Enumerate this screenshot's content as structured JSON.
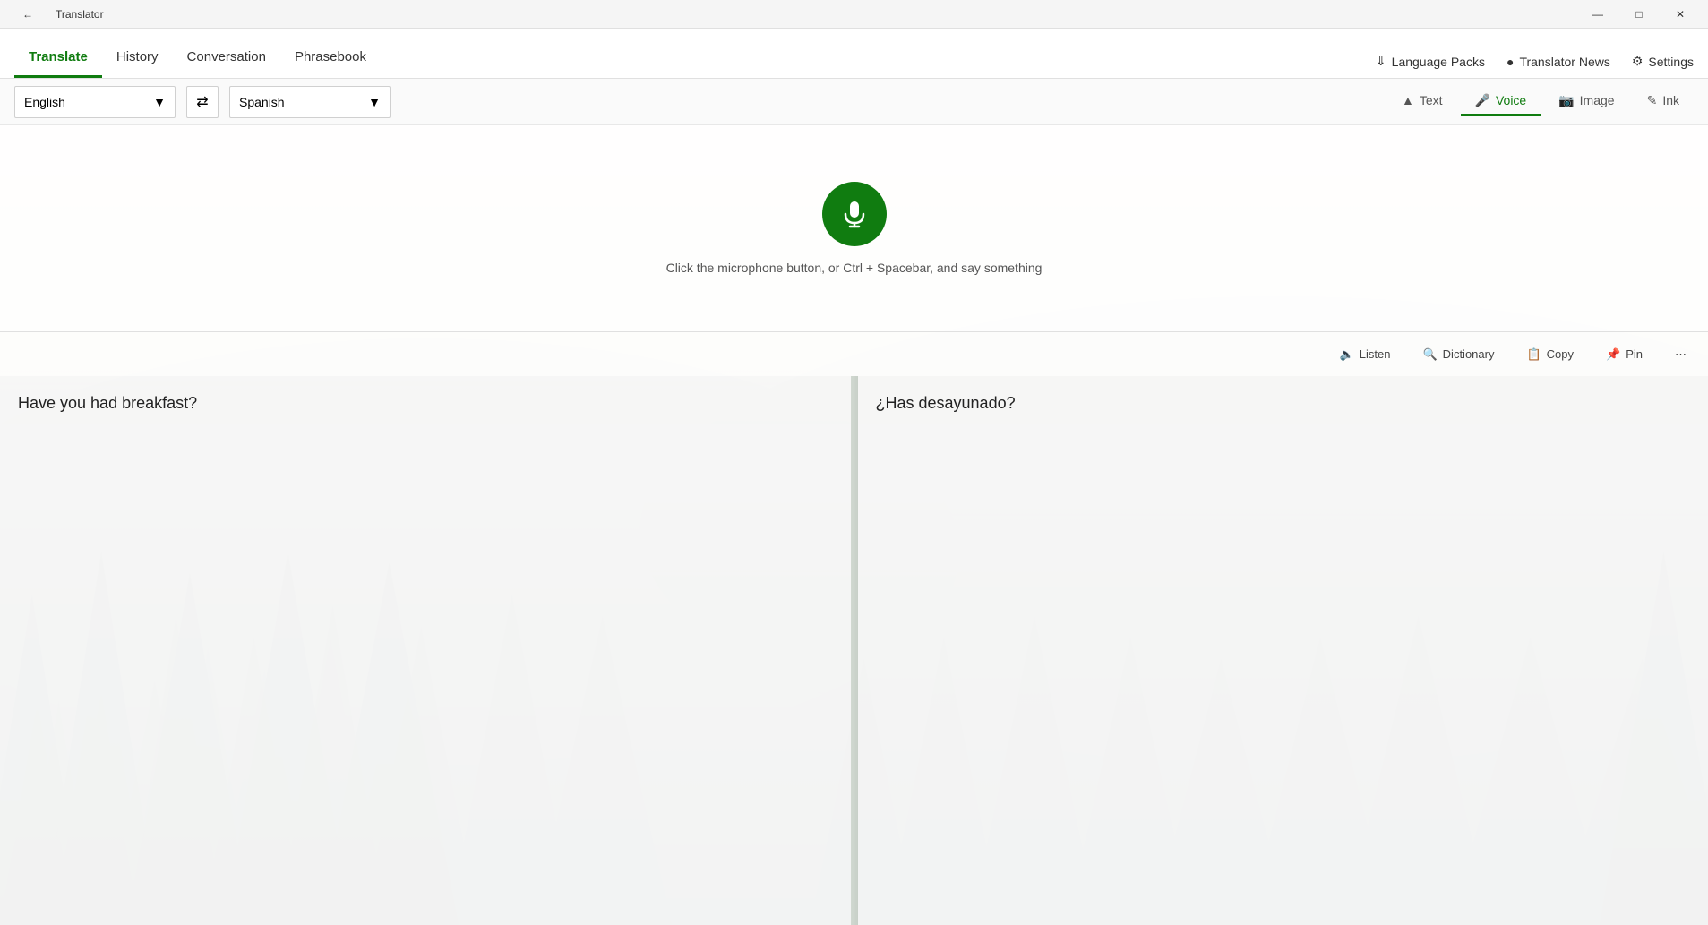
{
  "titleBar": {
    "title": "Translator",
    "back": "←",
    "minimize": "—",
    "restore": "□",
    "close": "✕"
  },
  "nav": {
    "tabs": [
      {
        "id": "translate",
        "label": "Translate",
        "active": true
      },
      {
        "id": "history",
        "label": "History",
        "active": false
      },
      {
        "id": "conversation",
        "label": "Conversation",
        "active": false
      },
      {
        "id": "phrasebook",
        "label": "Phrasebook",
        "active": false
      }
    ],
    "rightItems": [
      {
        "id": "language-packs",
        "label": "Language Packs",
        "icon": "download"
      },
      {
        "id": "translator-news",
        "label": "Translator News",
        "icon": "globe"
      },
      {
        "id": "settings",
        "label": "Settings",
        "icon": "gear"
      }
    ]
  },
  "langBar": {
    "sourceLang": "English",
    "targetLang": "Spanish",
    "swapIcon": "⇄",
    "modeTabs": [
      {
        "id": "text",
        "label": "Text",
        "active": false,
        "icon": "text"
      },
      {
        "id": "voice",
        "label": "Voice",
        "active": true,
        "icon": "microphone"
      },
      {
        "id": "image",
        "label": "Image",
        "active": false,
        "icon": "image"
      },
      {
        "id": "ink",
        "label": "Ink",
        "active": false,
        "icon": "pen"
      }
    ]
  },
  "recording": {
    "micIcon": "🎙",
    "hint": "Click the microphone button, or Ctrl + Spacebar, and say something"
  },
  "actionBar": {
    "listen": "Listen",
    "dictionary": "Dictionary",
    "copy": "Copy",
    "pin": "Pin",
    "more": "⋯"
  },
  "panels": {
    "sourceText": "Have you had breakfast?",
    "targetText": "¿Has desayunado?"
  },
  "colors": {
    "accent": "#107c10",
    "activeTab": "#107c10"
  }
}
